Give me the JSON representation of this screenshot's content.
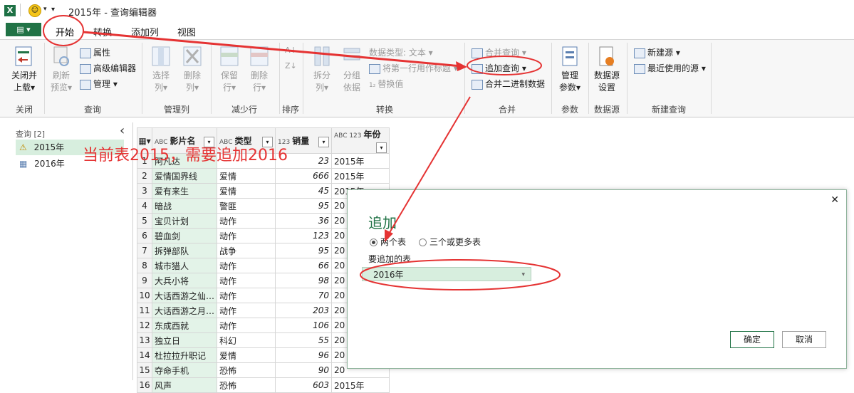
{
  "app": {
    "icon_label": "X",
    "title": "2015年 - 查询编辑器",
    "qat_arrow": "▾"
  },
  "ribbon": {
    "file_label": "▤ ▾",
    "tabs": [
      "开始",
      "转换",
      "添加列",
      "视图"
    ],
    "groups": {
      "close": {
        "button": "关闭并\n上载▾",
        "label": "关闭"
      },
      "query": {
        "refresh": "刷新\n预览▾",
        "properties": "属性",
        "advanced_editor": "高级编辑器",
        "manage": "管理 ▾",
        "label": "查询"
      },
      "manage_cols": {
        "choose": "选择\n列▾",
        "remove": "删除\n列▾",
        "label": "管理列"
      },
      "reduce_rows": {
        "keep": "保留\n行▾",
        "remove": "删除\n行▾",
        "label": "减少行"
      },
      "sort": {
        "label": "排序"
      },
      "transform": {
        "split": "拆分\n列▾",
        "group_by": "分组\n依据",
        "datatype": "数据类型: 文本 ▾",
        "first_row": "将第一行用作标题 ▾",
        "replace": "替换值",
        "label": "转换"
      },
      "combine": {
        "merge": "合并查询 ▾",
        "append": "追加查询 ▾",
        "binary": "合并二进制数据",
        "label": "合并"
      },
      "params": {
        "manage": "管理\n参数▾",
        "label": "参数"
      },
      "datasource": {
        "settings": "数据源\n设置",
        "label": "数据源"
      },
      "newquery": {
        "new_source": "新建源 ▾",
        "recent": "最近使用的源 ▾",
        "label": "新建查询"
      }
    }
  },
  "left_panel": {
    "header": "查询 [2]",
    "collapse_glyph": "‹",
    "queries": [
      {
        "name": "2015年",
        "icon": "warning-icon",
        "selected": true
      },
      {
        "name": "2016年",
        "icon": "table-icon",
        "selected": false
      }
    ]
  },
  "table": {
    "columns": [
      {
        "type": "ABC",
        "name": "影片名"
      },
      {
        "type": "ABC",
        "name": "类型"
      },
      {
        "type": "123",
        "name": "销量"
      },
      {
        "type": "ABC 123",
        "name": "年份"
      }
    ],
    "rows": [
      [
        "1",
        "阿凡达",
        "",
        "23",
        "2015年"
      ],
      [
        "2",
        "爱情国界线",
        "爱情",
        "666",
        "2015年"
      ],
      [
        "3",
        "爱有来生",
        "爱情",
        "45",
        "2015年"
      ],
      [
        "4",
        "暗战",
        "警匪",
        "95",
        "20"
      ],
      [
        "5",
        "宝贝计划",
        "动作",
        "36",
        "20"
      ],
      [
        "6",
        "碧血剑",
        "动作",
        "123",
        "20"
      ],
      [
        "7",
        "拆弹部队",
        "战争",
        "95",
        "20"
      ],
      [
        "8",
        "城市猎人",
        "动作",
        "66",
        "20"
      ],
      [
        "9",
        "大兵小将",
        "动作",
        "98",
        "20"
      ],
      [
        "10",
        "大话西游之仙…",
        "动作",
        "70",
        "20"
      ],
      [
        "11",
        "大话西游之月…",
        "动作",
        "203",
        "20"
      ],
      [
        "12",
        "东成西就",
        "动作",
        "106",
        "20"
      ],
      [
        "13",
        "独立日",
        "科幻",
        "55",
        "20"
      ],
      [
        "14",
        "杜拉拉升职记",
        "爱情",
        "96",
        "20"
      ],
      [
        "15",
        "夺命手机",
        "恐怖",
        "90",
        "20"
      ],
      [
        "16",
        "风声",
        "恐怖",
        "603",
        "2015年"
      ]
    ]
  },
  "dialog": {
    "title": "追加",
    "close": "✕",
    "radio_two": "两个表",
    "radio_three": "三个或更多表",
    "table_label": "要追加的表",
    "selected_table": "2016年",
    "ok": "确定",
    "cancel": "取消"
  },
  "annotation": {
    "text": "当前表2015，需要追加2016",
    "color": "#e53333"
  },
  "colors": {
    "accent": "#217346",
    "highlight": "#d7eede"
  }
}
